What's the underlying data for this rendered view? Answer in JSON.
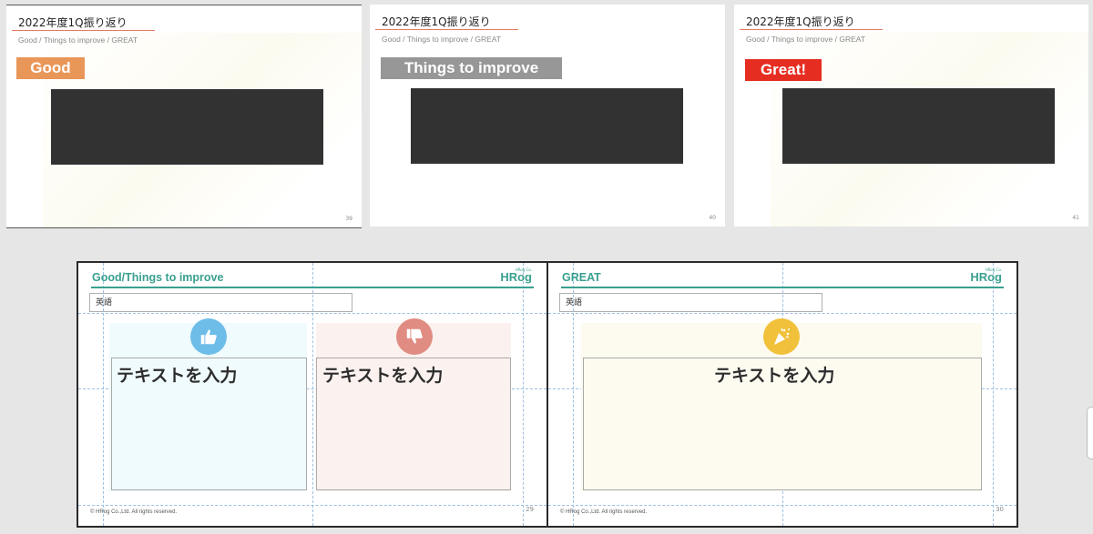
{
  "top_slides": [
    {
      "title": "2022年度1Q振り返り",
      "subtitle": "Good / Things to improve / GREAT",
      "badge": "Good",
      "page": "39"
    },
    {
      "title": "2022年度1Q振り返り",
      "subtitle": "Good / Things to improve / GREAT",
      "badge": "Things to improve",
      "page": "40"
    },
    {
      "title": "2022年度1Q振り返り",
      "subtitle": "Good / Things to improve / GREAT",
      "badge": "Great!",
      "page": "41"
    }
  ],
  "bottom_slides": [
    {
      "title": "Good/Things to improve",
      "logo": "HRog",
      "logo_tag": "HRog Co.",
      "lang": "英語",
      "columns": [
        {
          "text": "テキストを入力",
          "icon": "thumbs-up-icon",
          "color": "#6ebde9",
          "bg": "#f0fbfd"
        },
        {
          "text": "テキストを入力",
          "icon": "thumbs-down-icon",
          "color": "#e08c82",
          "bg": "#fbf1ef"
        }
      ],
      "footer": "© HRog Co.,Ltd. All rights reserved.",
      "page": "29"
    },
    {
      "title": "GREAT",
      "logo": "HRog",
      "logo_tag": "HRog Co.",
      "lang": "英語",
      "columns": [
        {
          "text": "テキストを入力",
          "icon": "party-popper-icon",
          "color": "#f1c13b",
          "bg": "#fdfaf0"
        }
      ],
      "footer": "© HRog Co.,Ltd. All rights reserved.",
      "page": "30"
    }
  ],
  "colors": {
    "accent_teal": "#3aa08f",
    "good_orange": "#e99659",
    "improve_gray": "#979797",
    "great_red": "#e62d21",
    "title_underline": "#e27b64"
  }
}
